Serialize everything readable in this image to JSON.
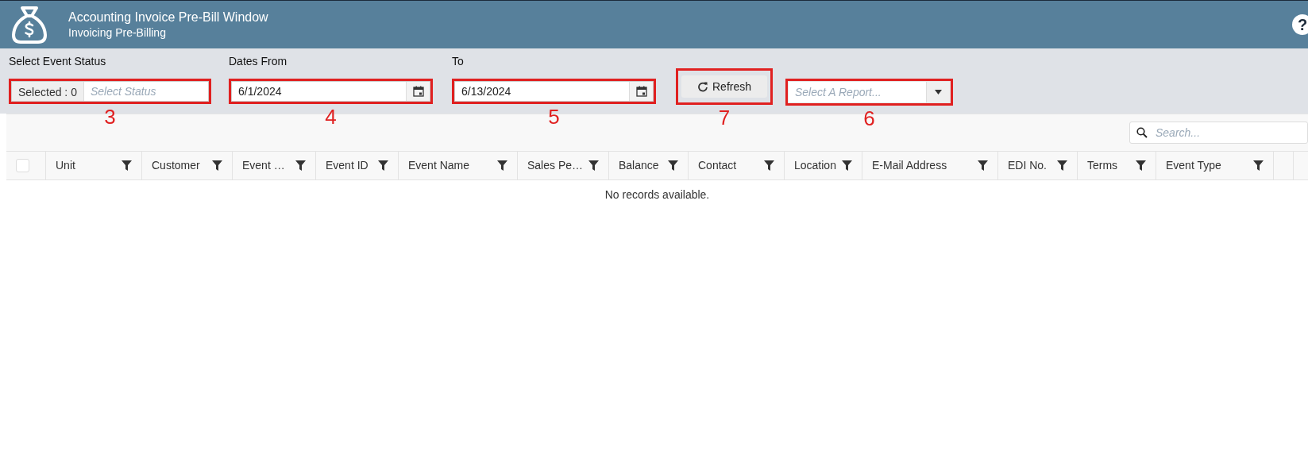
{
  "header": {
    "title": "Accounting Invoice Pre-Bill Window",
    "subtitle": "Invoicing Pre-Billing",
    "help": "?"
  },
  "filters": {
    "status": {
      "label": "Select Event Status",
      "selected_count": "Selected : 0",
      "placeholder": "Select Status",
      "annotation": "3"
    },
    "date_from": {
      "label": "Dates From",
      "value": "6/1/2024",
      "annotation": "4"
    },
    "date_to": {
      "label": "To",
      "value": "6/13/2024",
      "annotation": "5"
    },
    "refresh": {
      "label": "Refresh",
      "annotation": "7"
    },
    "report": {
      "placeholder": "Select A Report...",
      "annotation": "6"
    }
  },
  "grid": {
    "search": {
      "placeholder": "Search..."
    },
    "select_all": {
      "checked": false
    },
    "columns": [
      {
        "label": "Unit"
      },
      {
        "label": "Customer"
      },
      {
        "label": "Event …"
      },
      {
        "label": "Event ID"
      },
      {
        "label": "Event Name"
      },
      {
        "label": "Sales Pe…"
      },
      {
        "label": "Balance"
      },
      {
        "label": "Contact"
      },
      {
        "label": "Location"
      },
      {
        "label": "E-Mail Address"
      },
      {
        "label": "EDI No."
      },
      {
        "label": "Terms"
      },
      {
        "label": "Event Type"
      }
    ],
    "empty_message": "No records available."
  }
}
